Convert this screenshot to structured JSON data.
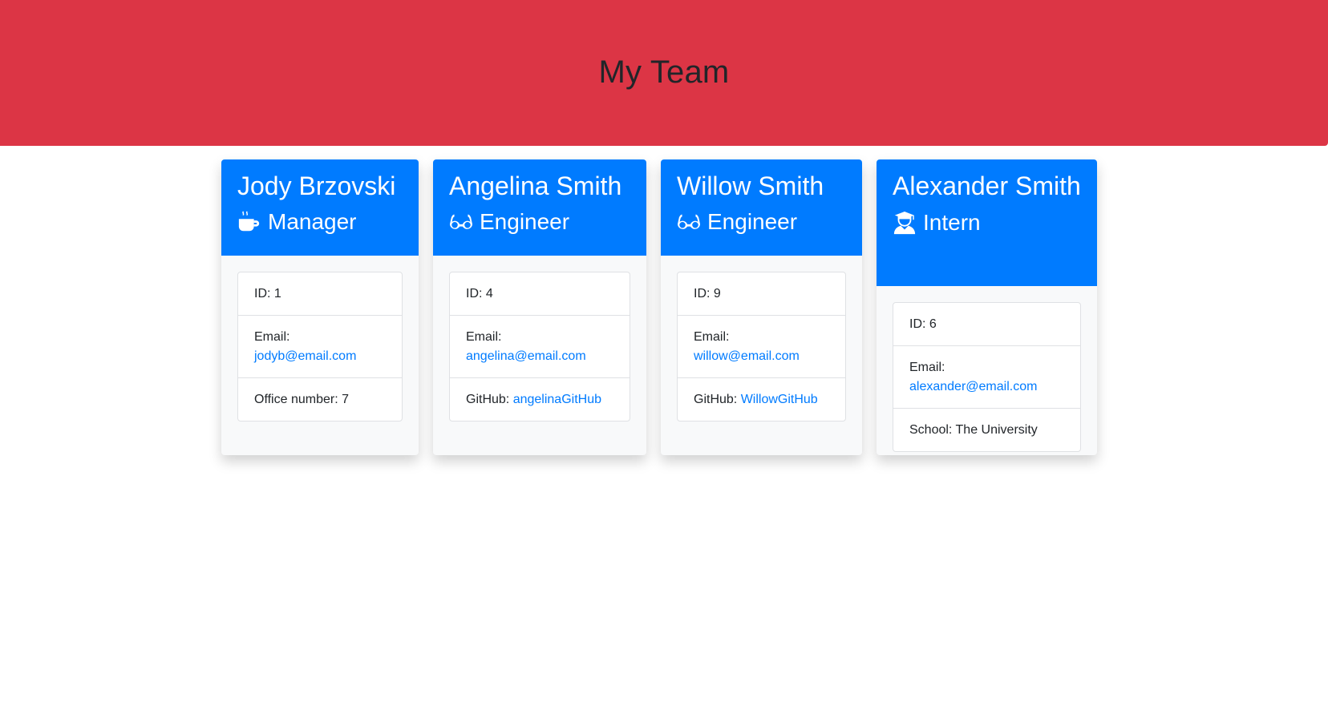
{
  "header": {
    "title": "My Team"
  },
  "accent_color": "#dc3545",
  "card_color": "#007bff",
  "cards": [
    {
      "name": "Jody Brzovski",
      "role": "Manager",
      "role_icon": "coffee-icon",
      "id_text": "ID: 1",
      "email_label": "Email:",
      "email": "jodyb@email.com",
      "extra_label": "Office number: 7",
      "extra_link": ""
    },
    {
      "name": "Angelina Smith",
      "role": "Engineer",
      "role_icon": "glasses-icon",
      "id_text": "ID: 4",
      "email_label": "Email:",
      "email": "angelina@email.com",
      "extra_label": "GitHub: ",
      "extra_link": "angelinaGitHub"
    },
    {
      "name": "Willow Smith",
      "role": "Engineer",
      "role_icon": "glasses-icon",
      "id_text": "ID: 9",
      "email_label": "Email:",
      "email": "willow@email.com",
      "extra_label": "GitHub: ",
      "extra_link": "WillowGitHub"
    },
    {
      "name": "Alexander Smith",
      "role": "Intern",
      "role_icon": "graduate-icon",
      "id_text": "ID: 6",
      "email_label": "Email:",
      "email": "alexander@email.com",
      "extra_label": "School: The University",
      "extra_link": ""
    }
  ]
}
